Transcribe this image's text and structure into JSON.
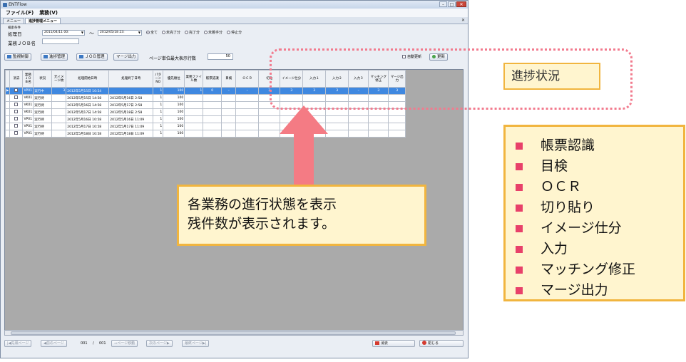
{
  "window": {
    "title": "ENTFlow",
    "controls": [
      "–",
      "□",
      "✕"
    ]
  },
  "menu": [
    "ファイル(F)",
    "業務(V)"
  ],
  "tabs": [
    "メニュー",
    "進捗管理メニュー"
  ],
  "tab_close": "✕",
  "search": {
    "condition_label": "検索条件",
    "date_label": "処理日",
    "date_from": "2011/04/11 00:",
    "tilde": "〜",
    "date_to": "2012/05/18 23:",
    "radios": [
      {
        "label": "全て",
        "checked": true
      },
      {
        "label": "未完了分",
        "checked": false
      },
      {
        "label": "完了分",
        "checked": false
      },
      {
        "label": "未着手分",
        "checked": false
      },
      {
        "label": "停止分",
        "checked": false
      }
    ],
    "job_label": "業務ＪＯＢ名",
    "job_value": ""
  },
  "toolbar": {
    "btn_monitor": "監視制御",
    "btn_progress": "進捗管理",
    "btn_job": "ＪＯＢ管理",
    "btn_merge": "マージ出力",
    "page_label": "ページ単位最大表示行数",
    "page_rows": "50",
    "auto_update": "自動更新",
    "btn_update": "更新"
  },
  "table": {
    "headers": [
      "消去",
      "業務ＪＯＢ名",
      "状況",
      "元イメージ枚",
      "処理開始日時",
      "処理終了日時",
      "パターンNO",
      "優先順位",
      "業務ファイル数",
      "帳票認識",
      "目検",
      "ＯＣＲ",
      "切貼",
      "イメージ仕分",
      "入力１",
      "入力２",
      "入力３",
      "マッチング修正",
      "マージ出力"
    ],
    "rows": [
      {
        "sel": true,
        "job": "VP01",
        "status": "実行中",
        "img": "3",
        "start": "2012年5月15日 10:54",
        "end": "",
        "pat": "1",
        "pri": "100",
        "files": "1",
        "c1": "0",
        "c2": "–",
        "c3": "–",
        "c4": "3",
        "c5": "3",
        "c6": "3",
        "c7": "3",
        "c8": "–",
        "c9": "3",
        "c10": "3"
      },
      {
        "sel": false,
        "job": "VK01",
        "status": "実行待",
        "img": "",
        "start": "2012年5月15日 14:58",
        "end": "2012年5月16日 2:58",
        "pat": "1",
        "pri": "100",
        "files": "",
        "c1": "",
        "c2": "",
        "c3": "",
        "c4": "",
        "c5": "",
        "c6": "",
        "c7": "",
        "c8": "",
        "c9": "",
        "c10": ""
      },
      {
        "sel": false,
        "job": "VK01",
        "status": "実行待",
        "img": "",
        "start": "2012年5月16日 14:58",
        "end": "2012年5月17日 2:58",
        "pat": "1",
        "pri": "100",
        "files": "",
        "c1": "",
        "c2": "",
        "c3": "",
        "c4": "",
        "c5": "",
        "c6": "",
        "c7": "",
        "c8": "",
        "c9": "",
        "c10": ""
      },
      {
        "sel": false,
        "job": "VK01",
        "status": "実行待",
        "img": "",
        "start": "2012年5月17日 14:58",
        "end": "2012年5月18日 2:58",
        "pat": "1",
        "pri": "100",
        "files": "",
        "c1": "",
        "c2": "",
        "c3": "",
        "c4": "",
        "c5": "",
        "c6": "",
        "c7": "",
        "c8": "",
        "c9": "",
        "c10": ""
      },
      {
        "sel": false,
        "job": "VP01",
        "status": "実行待",
        "img": "",
        "start": "2012年5月16日 10:58",
        "end": "2012年5月16日 11:09",
        "pat": "1",
        "pri": "100",
        "files": "",
        "c1": "",
        "c2": "",
        "c3": "",
        "c4": "",
        "c5": "",
        "c6": "",
        "c7": "",
        "c8": "",
        "c9": "",
        "c10": ""
      },
      {
        "sel": false,
        "job": "VP01",
        "status": "実行待",
        "img": "",
        "start": "2012年5月17日 10:58",
        "end": "2012年5月17日 11:09",
        "pat": "1",
        "pri": "100",
        "files": "",
        "c1": "",
        "c2": "",
        "c3": "",
        "c4": "",
        "c5": "",
        "c6": "",
        "c7": "",
        "c8": "",
        "c9": "",
        "c10": ""
      },
      {
        "sel": false,
        "job": "VP01",
        "status": "実行待",
        "img": "",
        "start": "2012年5月18日 10:58",
        "end": "2012年5月18日 11:09",
        "pat": "1",
        "pri": "100",
        "files": "",
        "c1": "",
        "c2": "",
        "c3": "",
        "c4": "",
        "c5": "",
        "c6": "",
        "c7": "",
        "c8": "",
        "c9": "",
        "c10": ""
      }
    ]
  },
  "pager": {
    "first": "先頭ページ",
    "prev": "前のページ",
    "current": "001",
    "sep": "/",
    "total": "001",
    "jump": "ページ移動",
    "next": "次のページ",
    "last": "最終ページ",
    "delete": "消去",
    "close": "閉じる"
  },
  "annotations": {
    "status_title": "進捗状況",
    "info_line1": "各業務の進行状態を表示",
    "info_line2": "残件数が表示されます。",
    "list": [
      "帳票認識",
      "目検",
      "ＯＣＲ",
      "切り貼り",
      "イメージ仕分",
      "入力",
      "マッチング修正",
      "マージ出力"
    ]
  },
  "colors": {
    "highlight_row": "#3f88e0",
    "callout_border": "#f1b53f",
    "callout_fill": "#fff5cf",
    "arrow": "#f47b84",
    "bullet": "#e8416a"
  }
}
